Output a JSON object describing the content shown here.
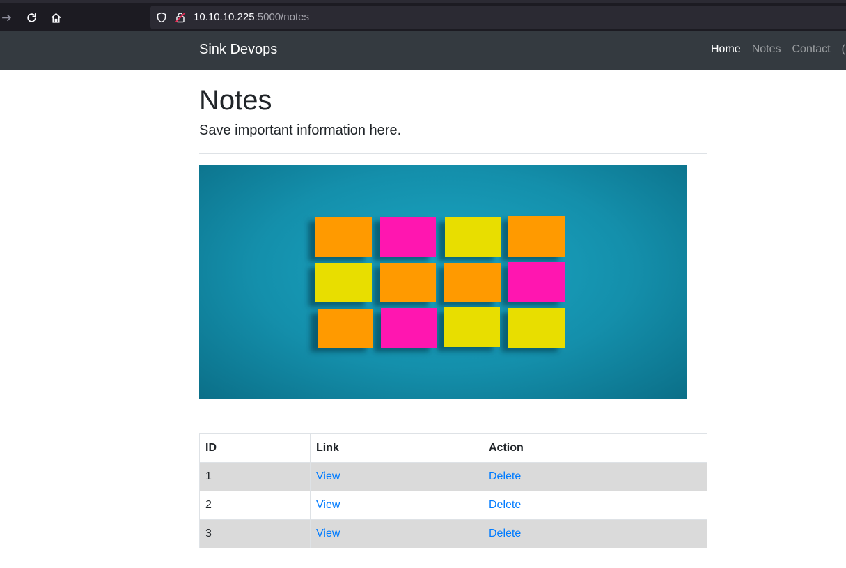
{
  "browser": {
    "url_host": "10.10.10.225",
    "url_rest": ":5000/notes"
  },
  "navbar": {
    "brand": "Sink Devops",
    "links": [
      {
        "label": "Home"
      },
      {
        "label": "Notes"
      },
      {
        "label": "Contact"
      },
      {
        "label": "("
      }
    ]
  },
  "page": {
    "title": "Notes",
    "subtitle": "Save important information here."
  },
  "hero_image": {
    "background_color": "#148fab",
    "sticky_note_colors": {
      "orange": "#ff9a00",
      "pink": "#ff12b0",
      "yellow": "#e8de00"
    }
  },
  "table": {
    "headers": [
      "ID",
      "Link",
      "Action"
    ],
    "rows": [
      {
        "id": "1",
        "link": "View",
        "action": "Delete"
      },
      {
        "id": "2",
        "link": "View",
        "action": "Delete"
      },
      {
        "id": "3",
        "link": "View",
        "action": "Delete"
      }
    ]
  },
  "colors": {
    "navbar_bg": "#343a40",
    "link": "#007bff",
    "row_stripe": "#dadada"
  }
}
